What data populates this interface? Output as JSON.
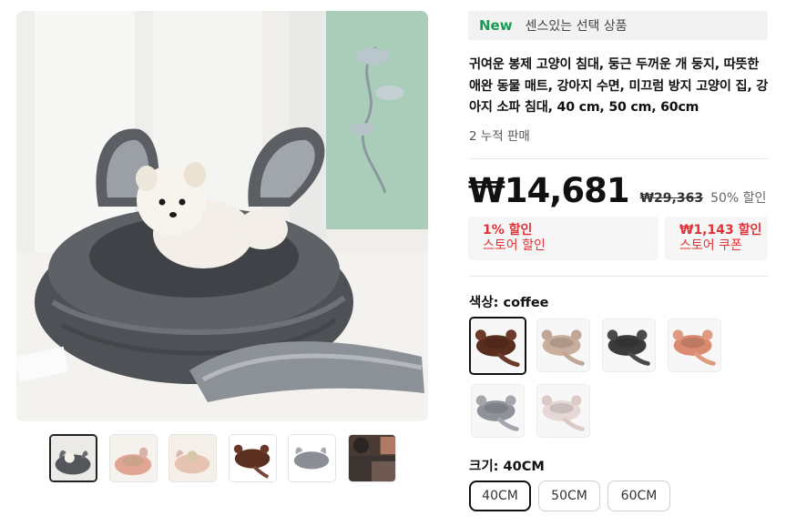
{
  "promo": {
    "badge": "New",
    "text": "센스있는 선택 상품"
  },
  "product": {
    "title": "귀여운 봉제 고양이 침대, 둥근 두꺼운 개 둥지, 따뜻한 애완 동물 매트, 강아지 수면, 미끄럼 방지 고양이 집, 강아지 소파 침대, 40 cm, 50 cm, 60cm",
    "sold": "2 누적 판매"
  },
  "price": {
    "current": "₩14,681",
    "original": "₩29,363",
    "discount": "50% 할인"
  },
  "coupons": [
    {
      "value": "1% 할인",
      "label": "스토어 할인"
    },
    {
      "value": "₩1,143 할인",
      "label": "스토어 쿠폰"
    }
  ],
  "color": {
    "label": "색상: coffee",
    "options": [
      {
        "name": "coffee",
        "bed": "#5a2e1f",
        "ear": "#6b3a2a",
        "selected": true
      },
      {
        "name": "khaki",
        "bed": "#c9ad9d",
        "ear": "#c2a595",
        "selected": false
      },
      {
        "name": "black",
        "bed": "#3b3b3d",
        "ear": "#4a4a4c",
        "selected": false
      },
      {
        "name": "orange",
        "bed": "#d98a70",
        "ear": "#e09a80",
        "selected": false
      },
      {
        "name": "gray",
        "bed": "#8f9399",
        "ear": "#a3a7ad",
        "selected": false
      },
      {
        "name": "pink",
        "bed": "#e6d8d6",
        "ear": "#ddcac7",
        "selected": false
      }
    ]
  },
  "size": {
    "label": "크기: 40CM",
    "options": [
      {
        "label": "40CM",
        "selected": true
      },
      {
        "label": "50CM",
        "selected": false
      },
      {
        "label": "60CM",
        "selected": false
      }
    ]
  },
  "gallery": {
    "thumbnails": [
      {
        "name": "dark-gray-bed-with-dog",
        "active": true
      },
      {
        "name": "pink-bed-with-cat",
        "active": false
      },
      {
        "name": "pink-bed-with-dog",
        "active": false
      },
      {
        "name": "coffee-bed",
        "active": false
      },
      {
        "name": "gray-bed",
        "active": false
      },
      {
        "name": "bed-closeup",
        "active": false
      }
    ]
  }
}
